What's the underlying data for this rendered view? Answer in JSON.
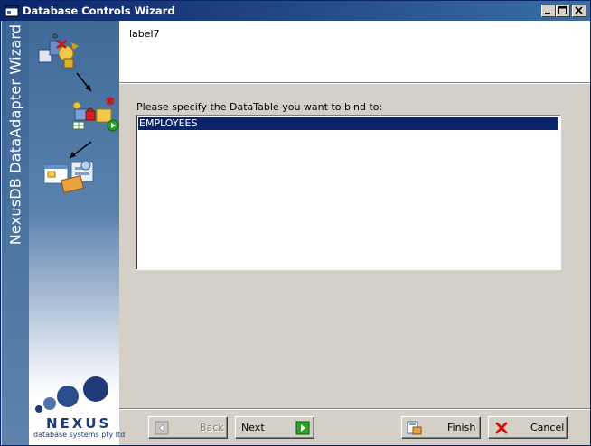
{
  "window": {
    "title": "Database Controls Wizard",
    "buttons": {
      "minimize": "minimize",
      "maximize": "maximize",
      "close": "close"
    }
  },
  "sidebar": {
    "vertical_title": "NexusDB DataAdapter Wizard",
    "logo_word": "NEXUS",
    "logo_tagline": "database systems pty ltd"
  },
  "header": {
    "label": "label7"
  },
  "main": {
    "prompt": "Please specify the DataTable you want to bind to:",
    "tables": [
      "EMPLOYEES"
    ],
    "selected_index": 0
  },
  "footer": {
    "back_label": "Back",
    "next_label": "Next",
    "finish_label": "Finish",
    "cancel_label": "Cancel"
  },
  "colors": {
    "title_bar": "#0a246a",
    "selection": "#0a246a",
    "sidebar": "#4a74a2",
    "logo": "#1e3b78",
    "dialog_face": "#d4d0c8"
  }
}
